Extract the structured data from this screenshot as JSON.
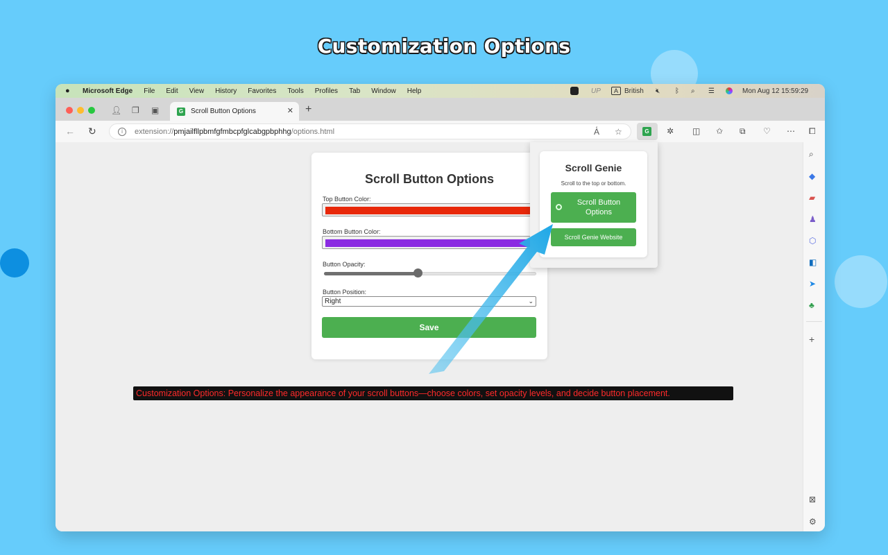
{
  "page": {
    "title": "Customization Options"
  },
  "menubar": {
    "app_name": "Microsoft Edge",
    "items": [
      "File",
      "Edit",
      "View",
      "History",
      "Favorites",
      "Tools",
      "Profiles",
      "Tab",
      "Window",
      "Help"
    ],
    "status": {
      "up": "UP",
      "input_badge": "A",
      "input_lang": "British",
      "datetime": "Mon Aug 12  15:59:29"
    }
  },
  "tabbar": {
    "tab_label": "Scroll Button Options",
    "tab_favicon": "G",
    "close": "✕",
    "new_tab": "+"
  },
  "toolbar": {
    "url_scheme": "extension://",
    "url_host": "pmjailfllpbmfgfmbcpfglcabgpbphhg",
    "url_path": "/options.html",
    "ext_icon": "G"
  },
  "options": {
    "title": "Scroll Button Options",
    "top_label": "Top Button Color:",
    "top_color": "#e8280a",
    "bottom_label": "Bottom Button Color:",
    "bottom_color": "#8b2be2",
    "opacity_label": "Button Opacity:",
    "opacity_value": 0.44,
    "position_label": "Button Position:",
    "position_value": "Right",
    "save_label": "Save"
  },
  "popup": {
    "title": "Scroll Genie",
    "subtitle": "Scroll to the top or bottom.",
    "options_button": "Scroll Button Options",
    "website_button": "Scroll Genie Website"
  },
  "caption": "Customization Options: Personalize the appearance of your scroll buttons—choose colors, set opacity levels, and decide button placement."
}
